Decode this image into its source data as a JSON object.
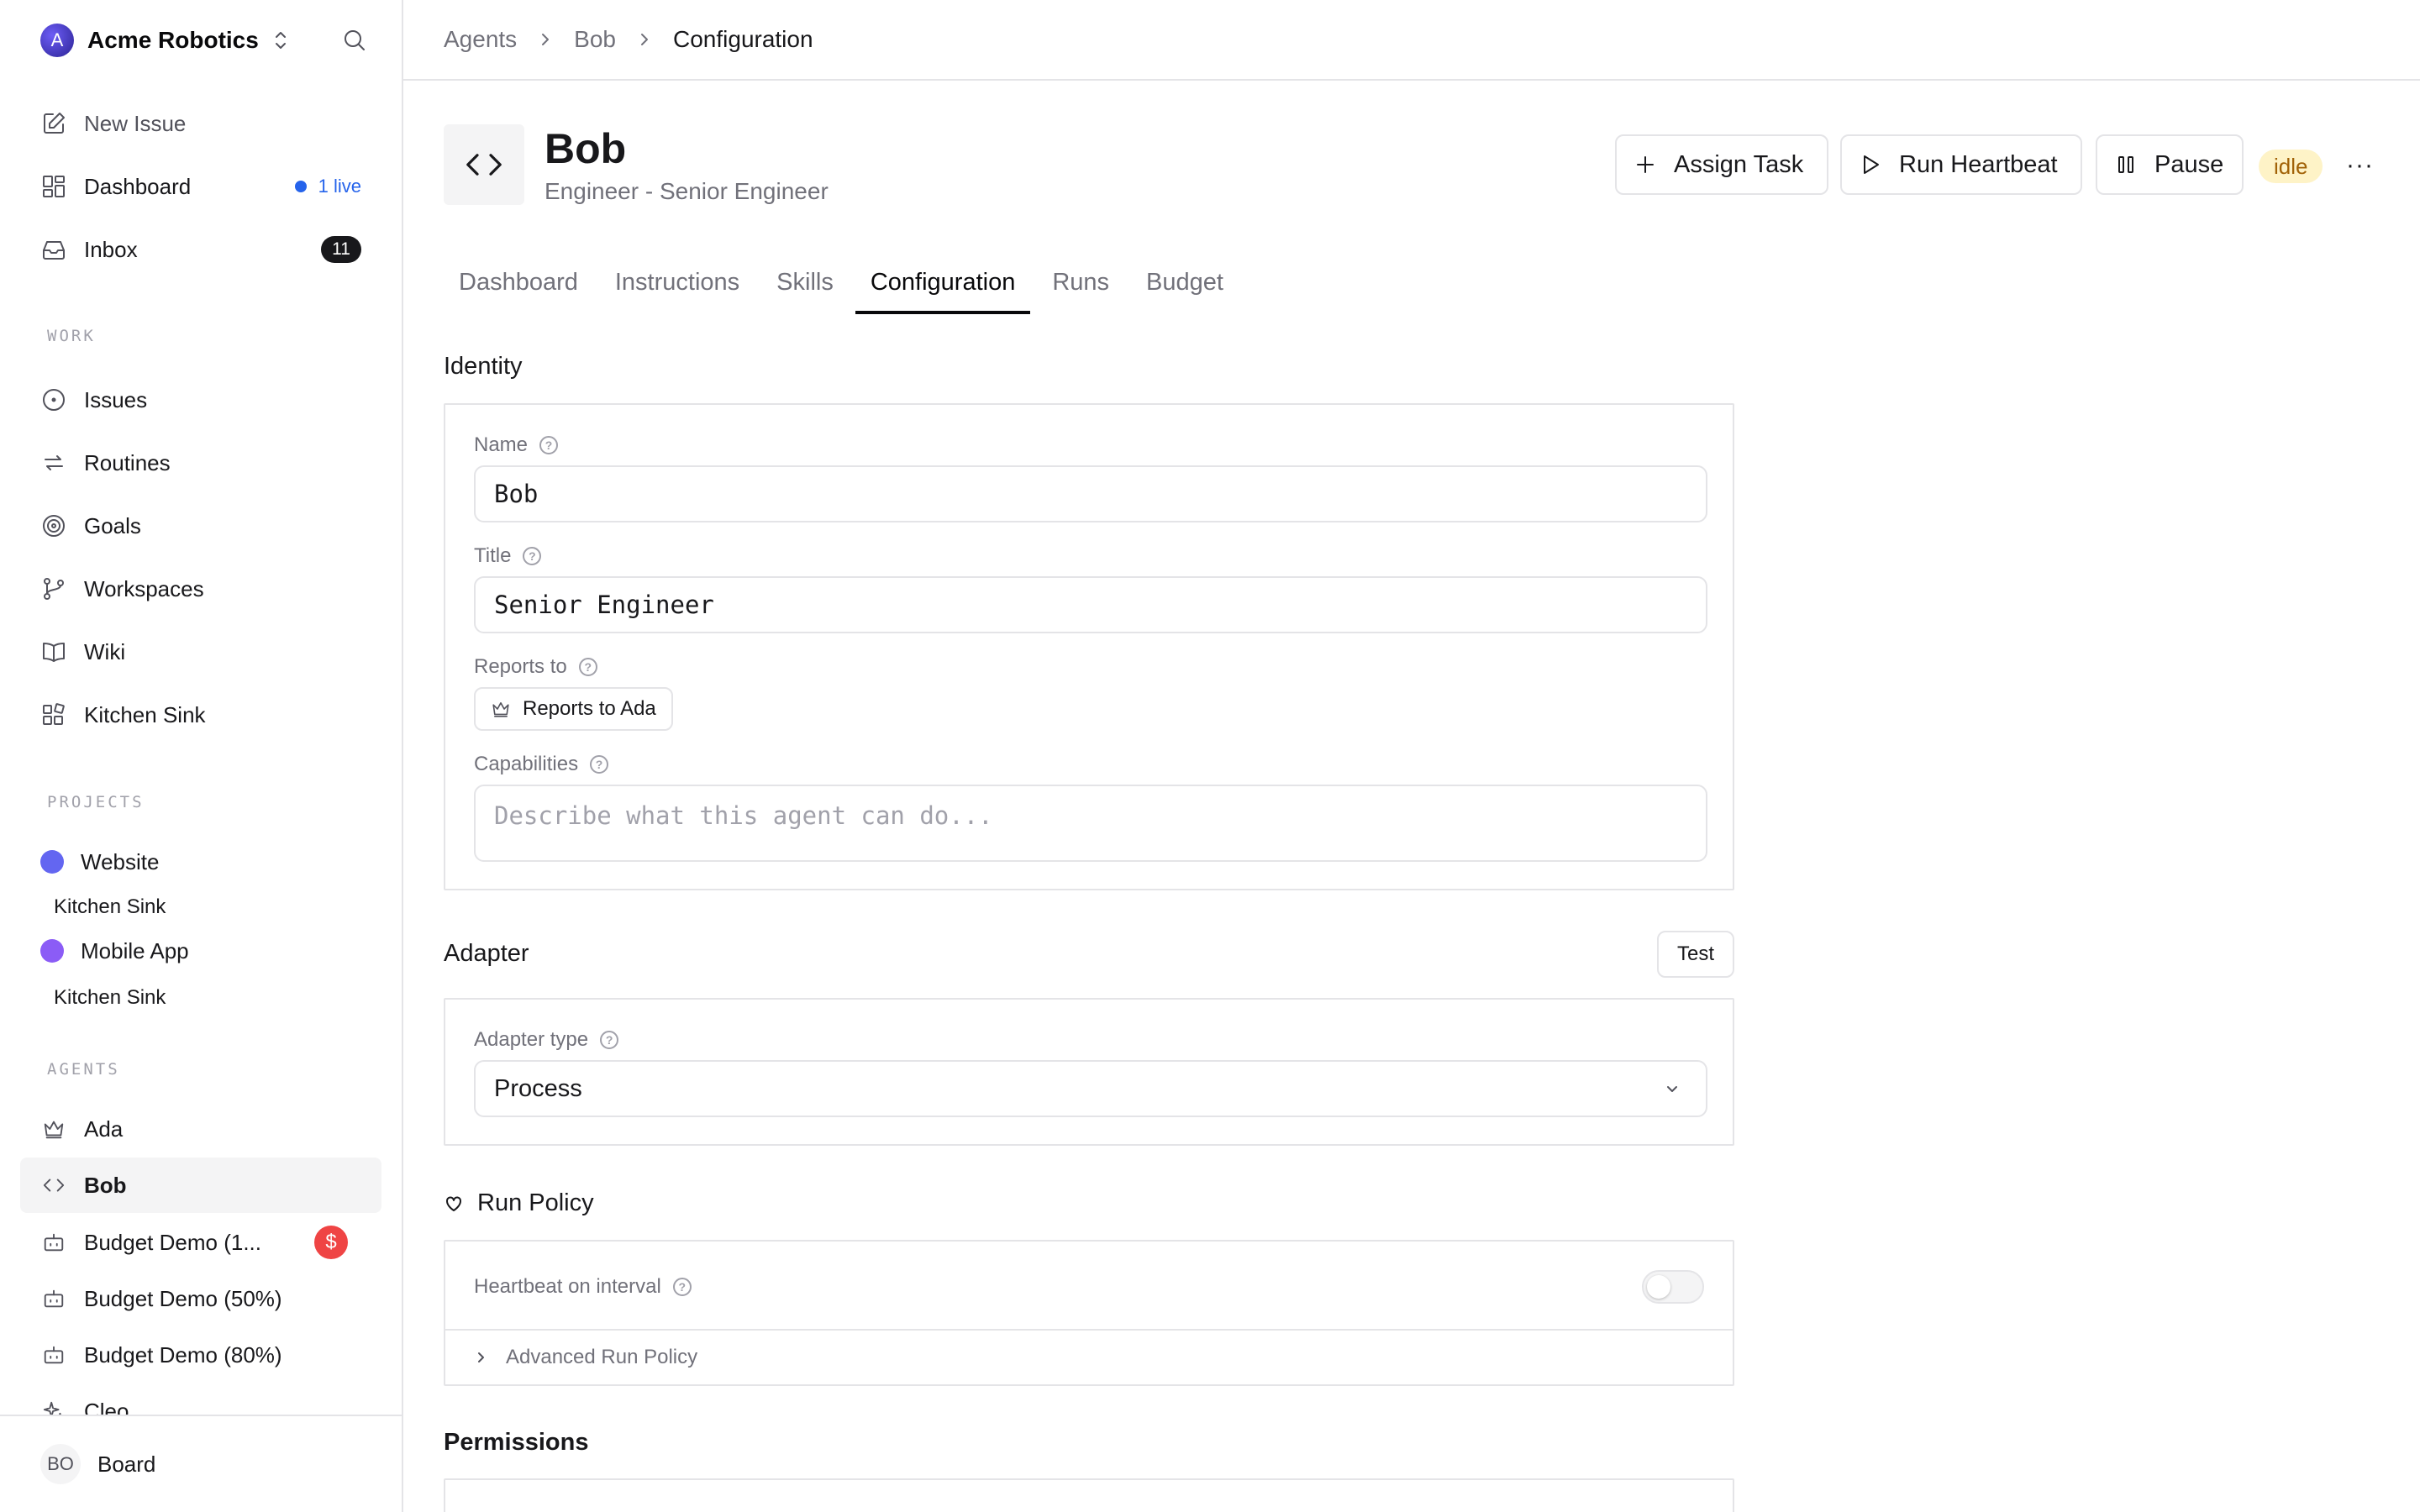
{
  "sidebar": {
    "org_initial": "A",
    "org_name": "Acme Robotics",
    "new_issue": "New Issue",
    "dashboard": "Dashboard",
    "live": "1 live",
    "inbox": "Inbox",
    "inbox_count": "11",
    "work_header": "WORK",
    "work": [
      "Issues",
      "Routines",
      "Goals",
      "Workspaces",
      "Wiki",
      "Kitchen Sink"
    ],
    "projects_header": "PROJECTS",
    "projects": [
      {
        "name": "Website",
        "color": "#6366f1",
        "sub": "Kitchen Sink"
      },
      {
        "name": "Mobile App",
        "color": "#8b5cf6",
        "sub": "Kitchen Sink"
      }
    ],
    "agents_header": "AGENTS",
    "agents": [
      "Ada",
      "Bob",
      "Budget Demo (1...",
      "Budget Demo (50%)",
      "Budget Demo (80%)",
      "Cleo"
    ],
    "warn_symbol": "$",
    "user_initials": "BO",
    "user_name": "Board"
  },
  "breadcrumb": [
    "Agents",
    "Bob",
    "Configuration"
  ],
  "agent": {
    "name": "Bob",
    "subtitle": "Engineer - Senior Engineer",
    "status": "idle"
  },
  "actions": {
    "assign": "Assign Task",
    "heartbeat": "Run Heartbeat",
    "pause": "Pause",
    "more": "···"
  },
  "tabs": [
    "Dashboard",
    "Instructions",
    "Skills",
    "Configuration",
    "Runs",
    "Budget"
  ],
  "identity": {
    "header": "Identity",
    "name_label": "Name",
    "name_value": "Bob",
    "title_label": "Title",
    "title_value": "Senior Engineer",
    "reports_label": "Reports to",
    "reports_value": "Reports to Ada",
    "capabilities_label": "Capabilities",
    "capabilities_placeholder": "Describe what this agent can do..."
  },
  "adapter": {
    "header": "Adapter",
    "test": "Test",
    "type_label": "Adapter type",
    "type_value": "Process"
  },
  "run_policy": {
    "header": "Run Policy",
    "heartbeat_label": "Heartbeat on interval",
    "heartbeat_enabled": false,
    "advanced": "Advanced Run Policy"
  },
  "permissions": {
    "header": "Permissions"
  }
}
